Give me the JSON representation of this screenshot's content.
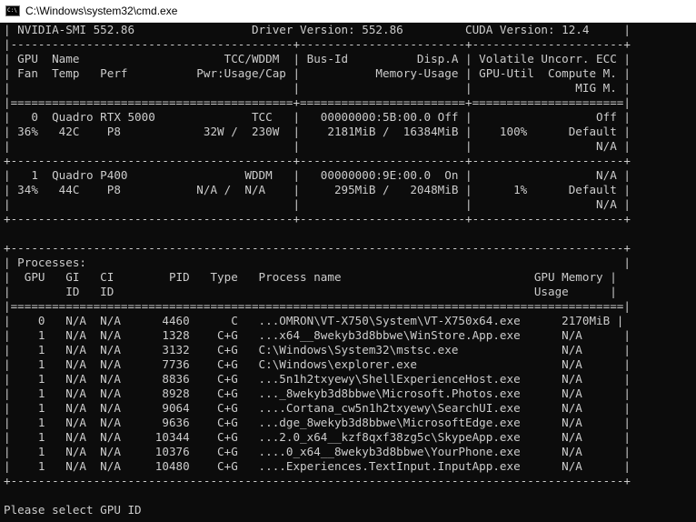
{
  "window": {
    "title": "C:\\Windows\\system32\\cmd.exe",
    "icon": "cmd-icon",
    "icon_glyph": "C:\\"
  },
  "colors": {
    "console_background": "#0c0c0c",
    "console_text": "#cccccc",
    "titlebar_background": "#ffffff"
  },
  "console": {
    "lines": [
      "| NVIDIA-SMI 552.86                 Driver Version: 552.86         CUDA Version: 12.4     |",
      "|-----------------------------------------+------------------------+----------------------+",
      "| GPU  Name                     TCC/WDDM  | Bus-Id          Disp.A | Volatile Uncorr. ECC |",
      "| Fan  Temp   Perf          Pwr:Usage/Cap |           Memory-Usage | GPU-Util  Compute M. |",
      "|                                         |                        |               MIG M. |",
      "|=========================================+========================+======================|",
      "|   0  Quadro RTX 5000              TCC   |   00000000:5B:00.0 Off |                  Off |",
      "| 36%   42C    P8            32W /  230W  |    2181MiB /  16384MiB |    100%      Default |",
      "|                                         |                        |                  N/A |",
      "+-----------------------------------------+------------------------+----------------------+",
      "|   1  Quadro P400                 WDDM   |   00000000:9E:00.0  On |                  N/A |",
      "| 34%   44C    P8           N/A /  N/A    |     295MiB /   2048MiB |      1%      Default |",
      "|                                         |                        |                  N/A |",
      "+-----------------------------------------+------------------------+----------------------+",
      "",
      "+-----------------------------------------------------------------------------------------+",
      "| Processes:                                                                              |",
      "|  GPU   GI   CI        PID   Type   Process name                            GPU Memory |",
      "|        ID   ID                                                             Usage      |",
      "|=========================================================================================|",
      "|    0   N/A  N/A      4460      C   ...OMRON\\VT-X750\\System\\VT-X750x64.exe      2170MiB |",
      "|    1   N/A  N/A      1328    C+G   ...x64__8wekyb3d8bbwe\\WinStore.App.exe      N/A      |",
      "|    1   N/A  N/A      3132    C+G   C:\\Windows\\System32\\mstsc.exe               N/A      |",
      "|    1   N/A  N/A      7736    C+G   C:\\Windows\\explorer.exe                     N/A      |",
      "|    1   N/A  N/A      8836    C+G   ...5n1h2txyewy\\ShellExperienceHost.exe      N/A      |",
      "|    1   N/A  N/A      8928    C+G   ..._8wekyb3d8bbwe\\Microsoft.Photos.exe      N/A      |",
      "|    1   N/A  N/A      9064    C+G   ....Cortana_cw5n1h2txyewy\\SearchUI.exe      N/A      |",
      "|    1   N/A  N/A      9636    C+G   ...dge_8wekyb3d8bbwe\\MicrosoftEdge.exe      N/A      |",
      "|    1   N/A  N/A     10344    C+G   ...2.0_x64__kzf8qxf38zg5c\\SkypeApp.exe      N/A      |",
      "|    1   N/A  N/A     10376    C+G   ....0_x64__8wekyb3d8bbwe\\YourPhone.exe      N/A      |",
      "|    1   N/A  N/A     10480    C+G   ....Experiences.TextInput.InputApp.exe      N/A      |",
      "+-----------------------------------------------------------------------------------------+",
      "",
      "Please select GPU ID"
    ]
  }
}
